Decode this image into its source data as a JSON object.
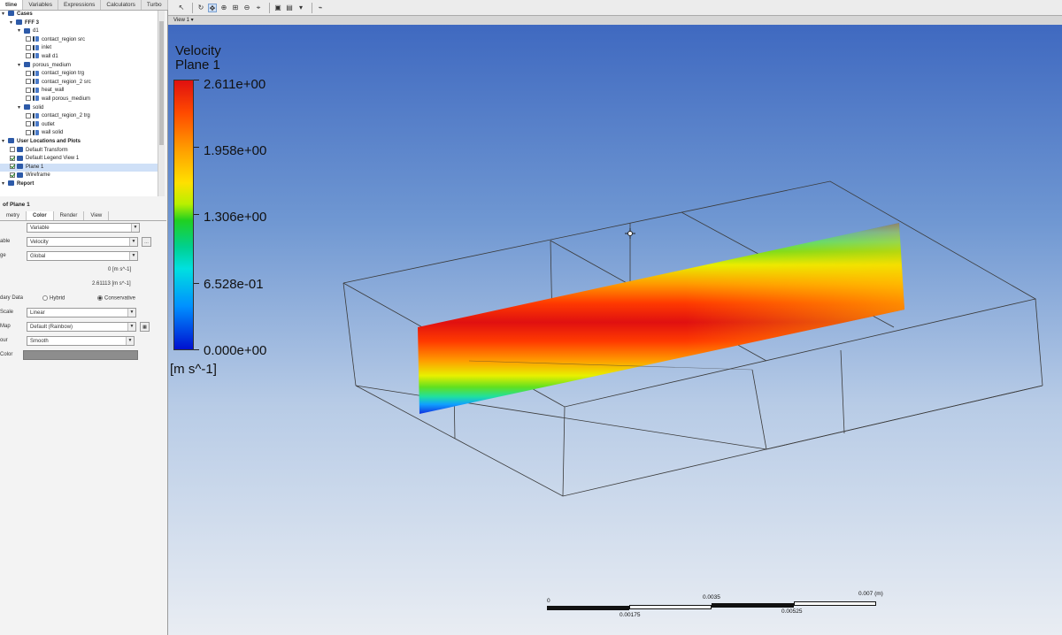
{
  "left_panel": {
    "tabs": [
      "tline",
      "Variables",
      "Expressions",
      "Calculators",
      "Turbo"
    ],
    "tree": [
      {
        "label": "Cases",
        "indent": 0,
        "type": "header",
        "bold": true
      },
      {
        "label": "FFF 3",
        "indent": 1,
        "type": "folder",
        "bold": true
      },
      {
        "label": "d1",
        "indent": 2,
        "type": "folder"
      },
      {
        "label": "contact_region src",
        "indent": 3,
        "type": "boundary"
      },
      {
        "label": "inlet",
        "indent": 3,
        "type": "boundary"
      },
      {
        "label": "wall d1",
        "indent": 3,
        "type": "boundary"
      },
      {
        "label": "porous_medium",
        "indent": 2,
        "type": "folder"
      },
      {
        "label": "contact_region trg",
        "indent": 3,
        "type": "boundary"
      },
      {
        "label": "contact_region_2 src",
        "indent": 3,
        "type": "boundary"
      },
      {
        "label": "heat_wall",
        "indent": 3,
        "type": "boundary"
      },
      {
        "label": "wall porous_medium",
        "indent": 3,
        "type": "boundary"
      },
      {
        "label": "solid",
        "indent": 2,
        "type": "folder"
      },
      {
        "label": "contact_region_2 trg",
        "indent": 3,
        "type": "boundary"
      },
      {
        "label": "outlet",
        "indent": 3,
        "type": "boundary"
      },
      {
        "label": "wall solid",
        "indent": 3,
        "type": "boundary"
      },
      {
        "label": "User Locations and Plots",
        "indent": 0,
        "type": "header",
        "bold": true
      },
      {
        "label": "Default Transform",
        "indent": 1,
        "type": "item"
      },
      {
        "label": "Default Legend View 1",
        "indent": 1,
        "type": "checked"
      },
      {
        "label": "Plane 1",
        "indent": 1,
        "type": "checked",
        "selected": true
      },
      {
        "label": "Wireframe",
        "indent": 1,
        "type": "checked"
      },
      {
        "label": "Report",
        "indent": 0,
        "type": "header",
        "bold": true
      }
    ],
    "details": {
      "title": "of Plane 1",
      "tabs": [
        "metry",
        "Color",
        "Render",
        "View"
      ],
      "mode_value": "Variable",
      "variable_label": "able",
      "variable_value": "Velocity",
      "range_label": "ge",
      "range_value": "Global",
      "min_value": "0 [m s^-1]",
      "max_value": "2.61113 [m s^-1]",
      "boundary_label": "dary Data",
      "boundary_opt1": "Hybrid",
      "boundary_opt2": "Conservative",
      "scale_label": "Scale",
      "scale_value": "Linear",
      "map_label": "Map",
      "map_value": "Default (Rainbow)",
      "undef_label": "our",
      "undef_value": "Smooth",
      "color_label": "Color"
    }
  },
  "viewport": {
    "view_name": "View 1",
    "legend": {
      "title": "Velocity",
      "subtitle": "Plane 1",
      "labels": [
        "2.611e+00",
        "1.958e+00",
        "1.306e+00",
        "6.528e-01",
        "0.000e+00"
      ],
      "unit": "[m s^-1]"
    },
    "scalebar": {
      "top_labels": [
        "0",
        "0.0035",
        "0.007  (m)"
      ],
      "bottom_labels": [
        "0.00175",
        "0.00525"
      ]
    },
    "colors": {
      "bg_top": "#3f69c0",
      "bg_bottom": "#e9edf3",
      "contour_max": "#e01010",
      "contour_min": "#0010d0"
    }
  }
}
